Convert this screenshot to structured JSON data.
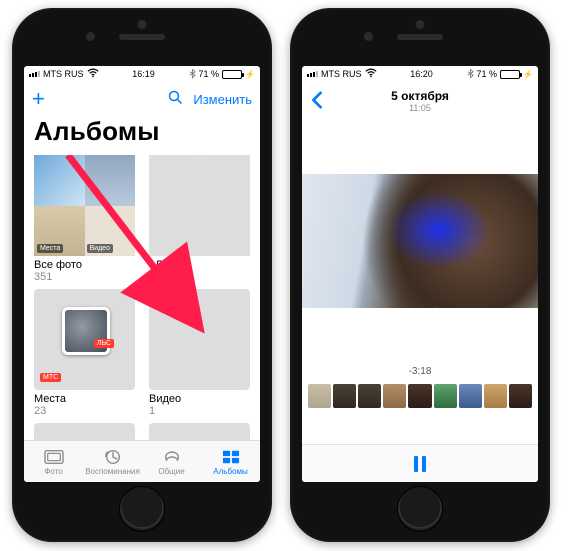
{
  "left": {
    "status": {
      "carrier": "MTS RUS",
      "time": "16:19",
      "battery_pct": "71 %"
    },
    "nav": {
      "edit": "Изменить"
    },
    "title": "Альбомы",
    "albums": [
      {
        "name": "Все фото",
        "count": "351",
        "tag_l": "Места",
        "tag_r": "Видео"
      },
      {
        "name": "Люди",
        "count": ""
      },
      {
        "name": "Места",
        "count": "23",
        "pin_badge": "МТС",
        "pin_badge2": "ЛЬС"
      },
      {
        "name": "Видео",
        "count": "1"
      }
    ],
    "tabs": {
      "photo": "Фото",
      "memories": "Воспоминания",
      "shared": "Общие",
      "albums": "Альбомы"
    }
  },
  "right": {
    "status": {
      "carrier": "MTS RUS",
      "time": "16:20",
      "battery_pct": "71 %"
    },
    "title": "5 октября",
    "subtitle": "11:05",
    "time_remaining": "-3:18"
  }
}
